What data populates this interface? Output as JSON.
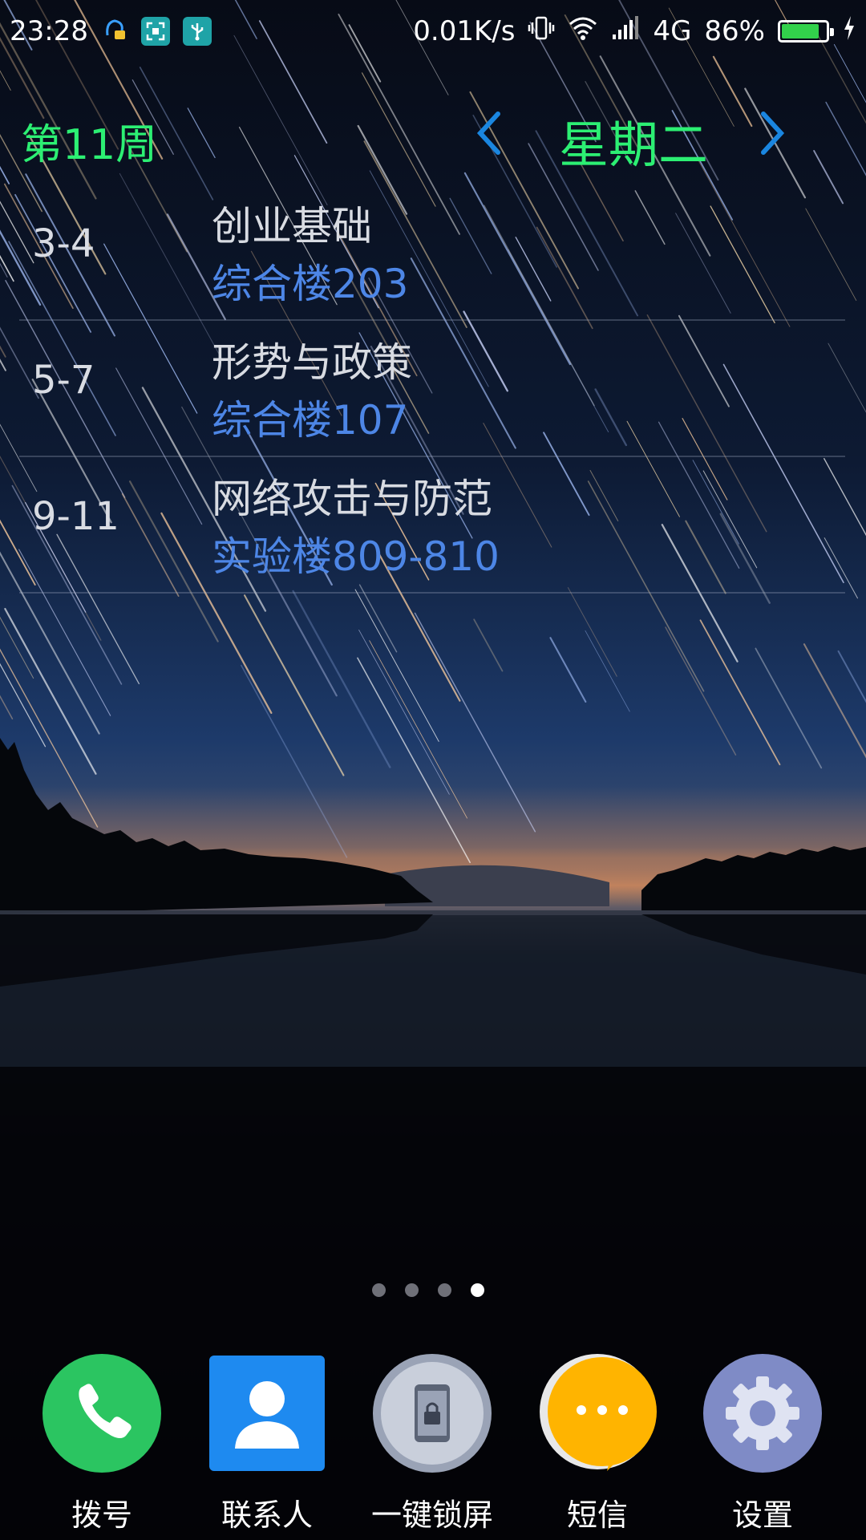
{
  "status_bar": {
    "time": "23:28",
    "net_speed": "0.01K/s",
    "network": "4G",
    "battery_percent": "86%",
    "battery_level": 0.86,
    "icons": [
      "assistant-icon",
      "screenshot-icon",
      "usb-icon",
      "vibrate-icon",
      "wifi-icon",
      "signal-icon",
      "battery-icon",
      "charging-icon"
    ]
  },
  "widget": {
    "week": "第11周",
    "day": "星期二",
    "classes": [
      {
        "period": "3-4",
        "name": "创业基础",
        "room": "综合楼203"
      },
      {
        "period": "5-7",
        "name": "形势与政策",
        "room": "综合楼107"
      },
      {
        "period": "9-11",
        "name": "网络攻击与防范",
        "room": "实验楼809-810"
      }
    ]
  },
  "page_indicator": {
    "count": 4,
    "active": 4
  },
  "dock": {
    "apps": [
      {
        "label": "拨号",
        "icon": "phone-icon",
        "color": "#19c154"
      },
      {
        "label": "联系人",
        "icon": "contacts-icon",
        "color": "#1e8af0"
      },
      {
        "label": "一键锁屏",
        "icon": "lock-screen-icon",
        "color": "#b9c0cf"
      },
      {
        "label": "短信",
        "icon": "message-icon",
        "color": "#ffb400"
      },
      {
        "label": "设置",
        "icon": "settings-icon",
        "color": "#7f8bc6"
      }
    ]
  },
  "colors": {
    "accent_green": "#2cef73",
    "room_blue": "#4d86e6"
  }
}
